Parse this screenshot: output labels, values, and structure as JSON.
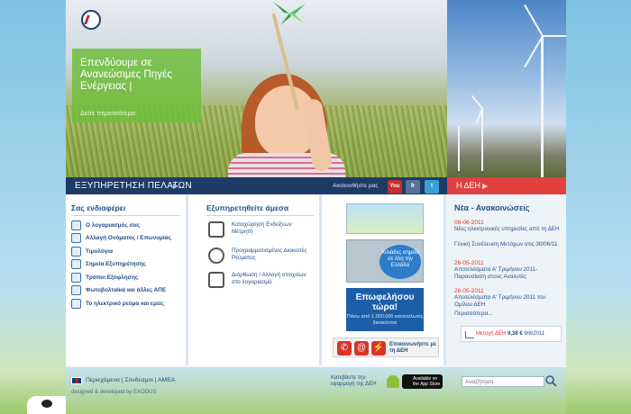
{
  "hero": {
    "headline": "Επενδύουμε σε Ανανεώσιμες Πηγές Ενέργειας |",
    "more_link": "Δείτε περισσότερα"
  },
  "service_bar": {
    "label": "ΕΞΥΠΗΡΕΤΗΣΗ ΠΕΛΑΤΩΝ",
    "follow_text": "Ακολουθήστε μας",
    "social": [
      "You Tube",
      "fr",
      "t"
    ]
  },
  "deh_bar": {
    "label": "Η ΔΕΗ"
  },
  "interests": {
    "title": "Σας ενδιαφέρει",
    "items": [
      "Ο λογαριασμός σας",
      "Αλλαγή Ονόματος / Επωνυμίας",
      "Τιμολόγια",
      "Σημεία Εξυπηρέτησης",
      "Τρόποι Εξόφλησης",
      "Φωτοβολταϊκά και άλλες ΑΠΕ",
      "Το ηλεκτρικό ρεύμα και εμείς"
    ]
  },
  "direct": {
    "title": "Εξυπηρετηθείτε άμεσα",
    "items": [
      "Καταχώρηση Ενδείξεων Μετρητή",
      "Προγραμματισμένες Διακοπές Ρεύματος",
      "Διόρθωση / Αλλαγή στοιχείων στο λογαριασμό"
    ]
  },
  "ads": {
    "map_text": "Χιλιάδες σημεία σε όλη την Ελλάδα",
    "promo_big": "Επωφελήσου τώρα!",
    "promo_small": "Πάνω από 1.000.000 καταναλωτές δικαιούνται",
    "contact": "Επικοινωνήστε με τη ΔΕΗ"
  },
  "news": {
    "title": "Νέα - Ανακοινώσεις",
    "items": [
      {
        "date": "08-06-2011",
        "title": "Νέες ηλεκτρονικές υπηρεσίες από τη ΔΕΗ"
      },
      {
        "date": "",
        "title": "Γενική Συνέλευση Μετόχων στις 30/06/11"
      },
      {
        "date": "26-05-2011",
        "title": "Αποτελέσματα Α' Τριμήνου 2011-Παρουσίαση στους Αναλυτές"
      },
      {
        "date": "26-05-2011",
        "title": "Αποτελέσματα Α' Τριμήνου 2011 του Ομίλου ΔΕΗ"
      }
    ],
    "more": "Περισσότερα...",
    "stock_label": "Μετοχή ΔΕΗ",
    "stock_value": "9,38 €",
    "stock_date": "9/6/2011"
  },
  "footer": {
    "links": "Περιεχόμενα | Σύνδεσμοι | ΑΜΕΑ",
    "designed": "designed & developed by EXODUS",
    "download": "Κατεβάστε την εφαρμογή της ΔΕΗ",
    "appstore": "Available on the App Store",
    "search_placeholder": "Αναζήτηση"
  },
  "colors": {
    "navy": "#1e3b68",
    "red": "#e0413f",
    "green": "#6ebe3c",
    "link": "#1f4f8a"
  }
}
